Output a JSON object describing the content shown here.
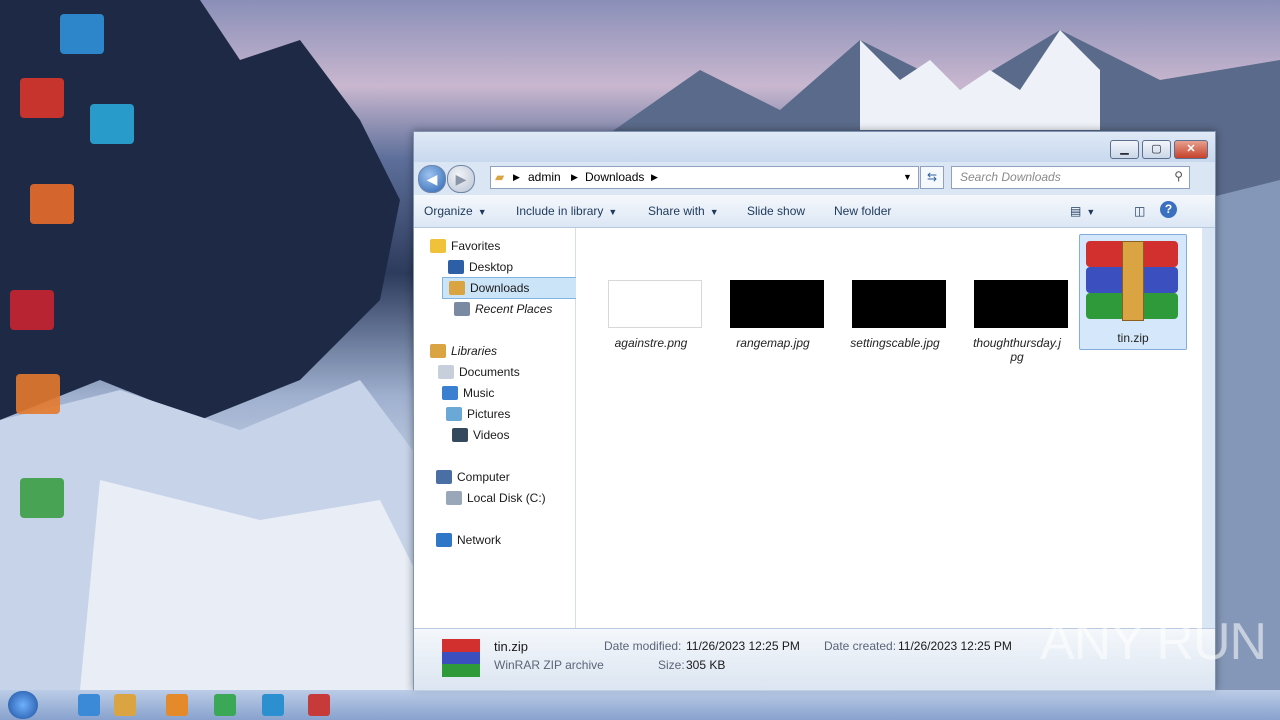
{
  "window": {
    "minimize_label": "▁",
    "maximize_label": "▢",
    "close_label": "✕"
  },
  "address": {
    "crumbs": [
      "admin",
      "Downloads"
    ],
    "search_placeholder": "Search Downloads"
  },
  "toolbar": {
    "organize": "Organize",
    "include_in_library": "Include in library",
    "share_with": "Share with",
    "slide_show": "Slide show",
    "new_folder": "New folder"
  },
  "nav": {
    "favorites": "Favorites",
    "desktop": "Desktop",
    "downloads": "Downloads",
    "recent_places": "Recent Places",
    "libraries": "Libraries",
    "documents": "Documents",
    "music": "Music",
    "pictures": "Pictures",
    "videos": "Videos",
    "computer": "Computer",
    "local_disk": "Local Disk (C:)",
    "network": "Network"
  },
  "files": [
    {
      "name": "againstre.png",
      "thumb": "white"
    },
    {
      "name": "rangemap.jpg",
      "thumb": "black"
    },
    {
      "name": "settingscable.jpg",
      "thumb": "black"
    },
    {
      "name": "thoughthursday.jpg",
      "thumb": "black"
    },
    {
      "name": "tin.zip",
      "thumb": "winrar",
      "selected": true
    }
  ],
  "status": {
    "filename": "tin.zip",
    "filetype": "WinRAR ZIP archive",
    "date_modified_label": "Date modified:",
    "date_modified": "11/26/2023 12:25 PM",
    "date_created_label": "Date created:",
    "date_created": "11/26/2023 12:25 PM",
    "size_label": "Size:",
    "size": "305 KB"
  },
  "watermark": "ANY RUN",
  "colors": {
    "selection": "#cce4f7",
    "toolbar_text": "#1e395b",
    "winrar_red": "#d22f2f",
    "winrar_blue": "#3b4fbf",
    "winrar_green": "#2f9a3a"
  }
}
